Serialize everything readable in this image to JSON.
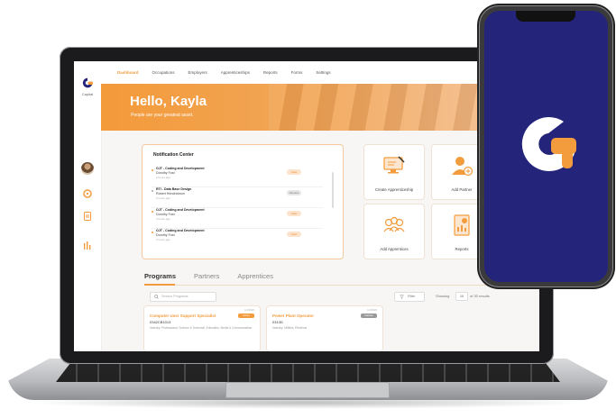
{
  "app": {
    "logo_label": "Capital",
    "brand_color": "#F39C3D",
    "phone_bg": "#23247A"
  },
  "nav": {
    "items": [
      "Dashboard",
      "Occupations",
      "Employers",
      "Apprenticeships",
      "Reports",
      "Forms",
      "Settings"
    ],
    "active": "Dashboard"
  },
  "sidebar": {
    "icons": [
      "avatar",
      "compass-icon",
      "folder-icon",
      "bar-chart-icon"
    ]
  },
  "banner": {
    "greeting": "Hello, Kayla",
    "tagline": "People are your greatest asset."
  },
  "notifications": {
    "title": "Notification Center",
    "items": [
      {
        "title": "OJT - Coding and Development",
        "sub": "Dorothy Fost",
        "time": "2 hours ago",
        "badge": "View"
      },
      {
        "title": "RTI - Data Base Design",
        "sub": "Robert Hendrickson",
        "time": "2 hours ago",
        "badge": "Resolve"
      },
      {
        "title": "OJT - Coding and Development",
        "sub": "Dorothy Fost",
        "time": "2 hours ago",
        "badge": "View"
      },
      {
        "title": "OJT - Coding and Development",
        "sub": "Dorothy Fost",
        "time": "2 hours ago",
        "badge": "View"
      }
    ]
  },
  "tiles": {
    "create": "Create Apprenticeship",
    "partner": "Add Partner",
    "apprentices": "Add Apprentices",
    "reports": "Reports"
  },
  "tabs": [
    "Programs",
    "Partners",
    "Apprentices"
  ],
  "search": {
    "placeholder": "Search Programs"
  },
  "filter": {
    "label": "Filter"
  },
  "showing": {
    "prefix": "Showing",
    "value": "10",
    "suffix": "of 30 results"
  },
  "programs": [
    {
      "title": "Computer User Support Specialist",
      "code": "0342CB1013",
      "industry": "Industry: Professional, Science & Technical, Education, Media & Communication",
      "tag": "Active",
      "date": "1/1/2020"
    },
    {
      "title": "Power Plant Operator",
      "code": "0313D",
      "industry": "Industry: Utilities, Electrical",
      "tag": "Inactive",
      "date": "1/1/2020"
    }
  ]
}
